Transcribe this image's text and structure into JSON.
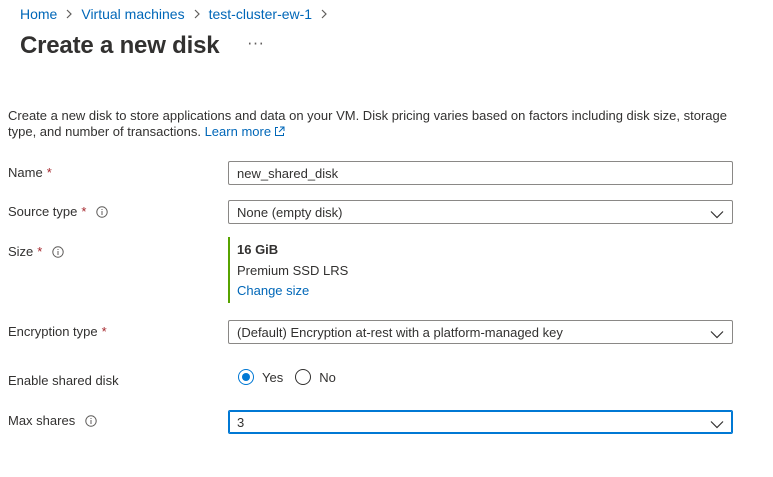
{
  "breadcrumb": {
    "items": [
      "Home",
      "Virtual machines",
      "test-cluster-ew-1"
    ]
  },
  "header": {
    "title": "Create a new disk",
    "more": "···"
  },
  "description": {
    "text": "Create a new disk to store applications and data on your VM. Disk pricing varies based on factors including disk size, storage type, and number of transactions.",
    "link": "Learn more"
  },
  "form": {
    "name": {
      "label": "Name",
      "required": "*",
      "value": "new_shared_disk"
    },
    "source_type": {
      "label": "Source type",
      "required": "*",
      "value": "None (empty disk)"
    },
    "size": {
      "label": "Size",
      "required": "*",
      "value": "16 GiB",
      "sku": "Premium SSD LRS",
      "change_link": "Change size"
    },
    "encryption_type": {
      "label": "Encryption type",
      "required": "*",
      "value": "(Default) Encryption at-rest with a platform-managed key"
    },
    "shared_disk": {
      "label": "Enable shared disk",
      "options": [
        "Yes",
        "No"
      ],
      "selected": "Yes"
    },
    "max_shares": {
      "label": "Max shares",
      "value": "3"
    }
  },
  "colors": {
    "link": "#0067b8",
    "accent": "#0078d4",
    "required": "#a4262c",
    "size_bar": "#57a300"
  }
}
